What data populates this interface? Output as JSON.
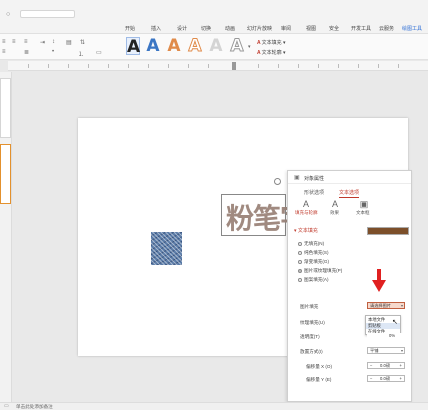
{
  "menu_tabs": [
    {
      "label": "开始",
      "active": false
    },
    {
      "label": "插入",
      "active": false
    },
    {
      "label": "设计",
      "active": false
    },
    {
      "label": "切换",
      "active": false
    },
    {
      "label": "动画",
      "active": false
    },
    {
      "label": "幻灯片放映",
      "active": false
    },
    {
      "label": "审阅",
      "active": false
    },
    {
      "label": "视图",
      "active": false
    },
    {
      "label": "安全",
      "active": false
    },
    {
      "label": "开发工具",
      "active": false
    },
    {
      "label": "云服务",
      "active": false
    },
    {
      "label": "绘图工具",
      "active": true
    }
  ],
  "ribbon": {
    "wordart_glyph": "A",
    "text_fill_label": "文本填充",
    "text_outline_label": "文本轮廓",
    "wordart_colors": [
      "#222222",
      "#3b76c4",
      "#e08b4a",
      "#ffffff",
      "#cccccc",
      "#ffffff"
    ]
  },
  "slide": {
    "wordart_text": "粉笔字"
  },
  "properties_pane": {
    "title": "对象属性",
    "tabs": {
      "shape": "形状选项",
      "text": "文本选项"
    },
    "subtabs": {
      "fill": "填充与轮廓",
      "effect": "效果",
      "textbox": "文本框"
    },
    "section": "文本填充",
    "fill_options": [
      {
        "label": "无填充(N)",
        "checked": false
      },
      {
        "label": "纯色填充(S)",
        "checked": false
      },
      {
        "label": "渐变填充(G)",
        "checked": false
      },
      {
        "label": "图片或纹理填充(P)",
        "checked": true
      },
      {
        "label": "图案填充(A)",
        "checked": false
      }
    ],
    "picture_fill_label": "图片填充",
    "picture_fill_value": "请选择图片",
    "dropdown_options": [
      "本地文件",
      "剪贴板",
      "在线文件"
    ],
    "dropdown_highlight": "剪贴板",
    "texture_label": "纹理填充(U)",
    "transparency_label": "透明度(T)",
    "transparency_value": "0%",
    "placement_label": "放置方式(I)",
    "placement_value": "平铺",
    "offset_x_label": "偏移量 X (O)",
    "offset_x_value": "0.0磅",
    "offset_y_label": "偏移量 Y (E)",
    "offset_y_value": "0.0磅",
    "minus": "−",
    "plus": "+"
  },
  "status": {
    "notes_placeholder": "单击此处添加备注"
  }
}
